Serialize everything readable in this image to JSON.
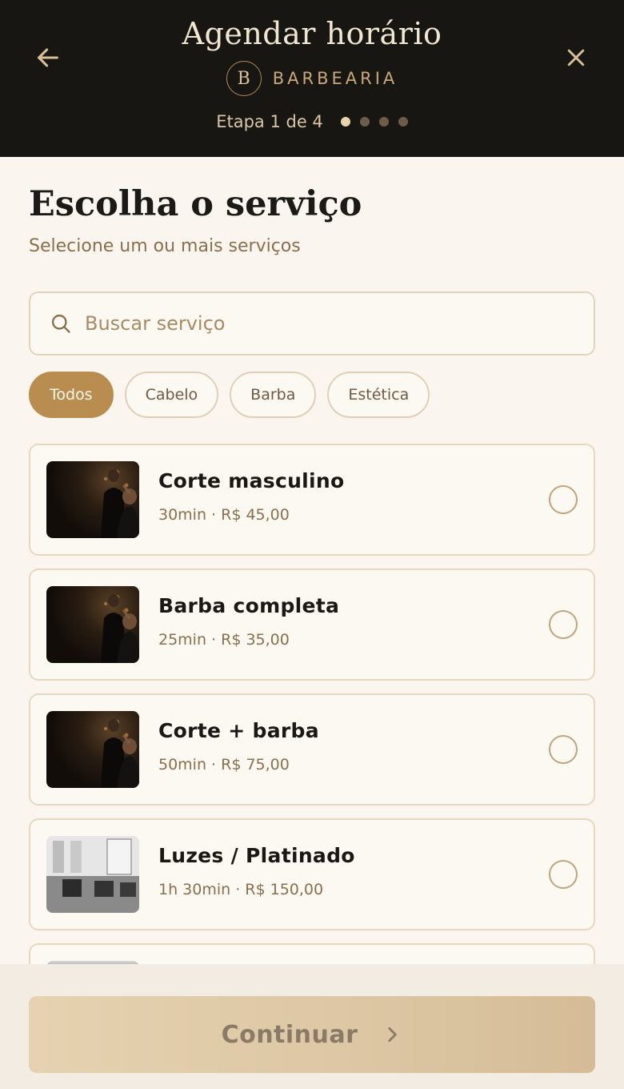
{
  "header": {
    "title": "Agendar horário",
    "brand_initial": "B",
    "brand_name": "BARBEARIA",
    "step_label": "Etapa 1 de 4",
    "step_current": 1,
    "step_total": 4
  },
  "main": {
    "title": "Escolha o serviço",
    "subtitle": "Selecione um ou mais serviços",
    "search": {
      "placeholder": "Buscar serviço",
      "value": ""
    },
    "filters": [
      {
        "label": "Todos",
        "active": true
      },
      {
        "label": "Cabelo",
        "active": false
      },
      {
        "label": "Barba",
        "active": false
      },
      {
        "label": "Estética",
        "active": false
      }
    ],
    "services": [
      {
        "name": "Corte masculino",
        "meta": "30min · R$ 45,00",
        "thumb": "dark",
        "selected": false
      },
      {
        "name": "Barba completa",
        "meta": "25min · R$ 35,00",
        "thumb": "dark",
        "selected": false
      },
      {
        "name": "Corte + barba",
        "meta": "50min · R$ 75,00",
        "thumb": "dark",
        "selected": false
      },
      {
        "name": "Luzes / Platinado",
        "meta": "1h 30min · R$ 150,00",
        "thumb": "light",
        "selected": false
      }
    ]
  },
  "footer": {
    "continue_label": "Continuar"
  },
  "colors": {
    "accent": "#b98d4f",
    "header_bg": "#181613",
    "page_bg": "#faf6ef"
  },
  "icons": {
    "back": "arrow-left-icon",
    "close": "close-icon",
    "search": "search-icon",
    "continue": "chevron-right-icon"
  }
}
